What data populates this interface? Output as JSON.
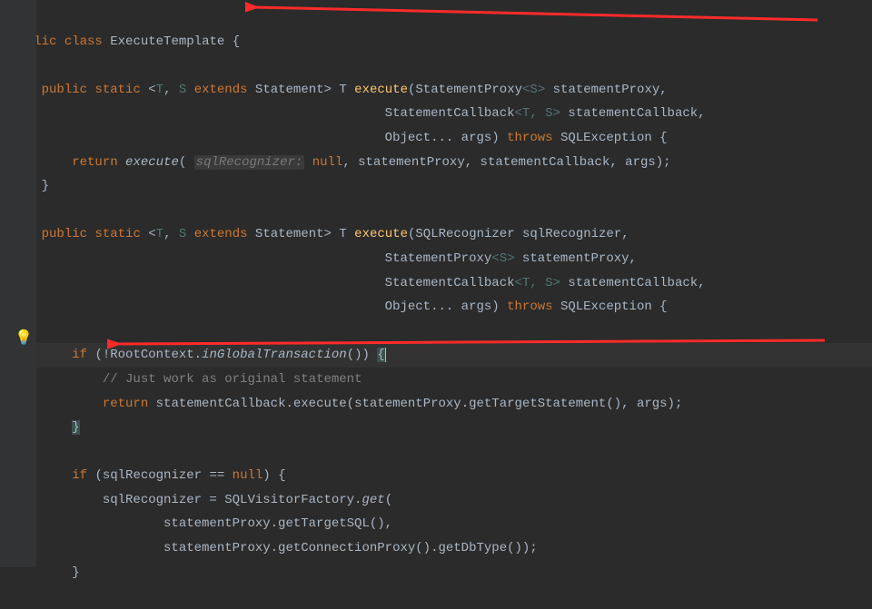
{
  "code": {
    "l1_public": "public",
    "l1_class": "class",
    "l1_name": "ExecuteTemplate",
    "l1_brace": "{",
    "l3_public": "public",
    "l3_static": "static",
    "l3_gen_open": "<",
    "l3_T": "T",
    "l3_comma": ", ",
    "l3_S": "S",
    "l3_extends": "extends",
    "l3_Statement": "Statement",
    "l3_gen_close": ">",
    "l3_ret": "T",
    "l3_method": "execute",
    "l3_p1": "(StatementProxy",
    "l3_p1g": "<S>",
    "l3_p1name": " statementProxy,",
    "l4_pad": "                                                 ",
    "l4_p2": "StatementCallback",
    "l4_p2g": "<T, S>",
    "l4_p2name": " statementCallback,",
    "l5_p3": "Object... args)",
    "l5_throws": "throws",
    "l5_exc": "SQLException {",
    "l6_return": "return",
    "l6_call": "execute",
    "l6_hint": "sqlRecognizer:",
    "l6_null": "null",
    "l6_rest": ", statementProxy, statementCallback, args);",
    "l7_brace": "    }",
    "l9_public": "public",
    "l9_static": "static",
    "l9_method": "execute",
    "l9_p1": "(SQLRecognizer sqlRecognizer,",
    "l10_p2": "StatementProxy",
    "l10_p2g": "<S>",
    "l10_p2name": " statementProxy,",
    "l11_p3": "StatementCallback",
    "l11_p3g": "<T, S>",
    "l11_p3name": " statementCallback,",
    "l12_p4": "Object... args)",
    "l12_throws": "throws",
    "l12_exc": "SQLException {",
    "l14_if": "if",
    "l14_cond1": "(!RootContext.",
    "l14_cond2": "inGlobalTransaction",
    "l14_cond3": "()) ",
    "l14_brace": "{",
    "l15_comment": "// Just work as original statement",
    "l16_return": "return",
    "l16_rest": " statementCallback.execute(statementProxy.getTargetStatement(), args);",
    "l17_brace": "}",
    "l19_if": "if",
    "l19_cond": "(sqlRecognizer == ",
    "l19_null": "null",
    "l19_rest": ") {",
    "l20_lhs": "            sqlRecognizer = SQLVisitorFactory.",
    "l20_get": "get",
    "l20_paren": "(",
    "l21": "                    statementProxy.getTargetSQL(),",
    "l22": "                    statementProxy.getConnectionProxy().getDbType());",
    "l23_brace": "        }"
  }
}
